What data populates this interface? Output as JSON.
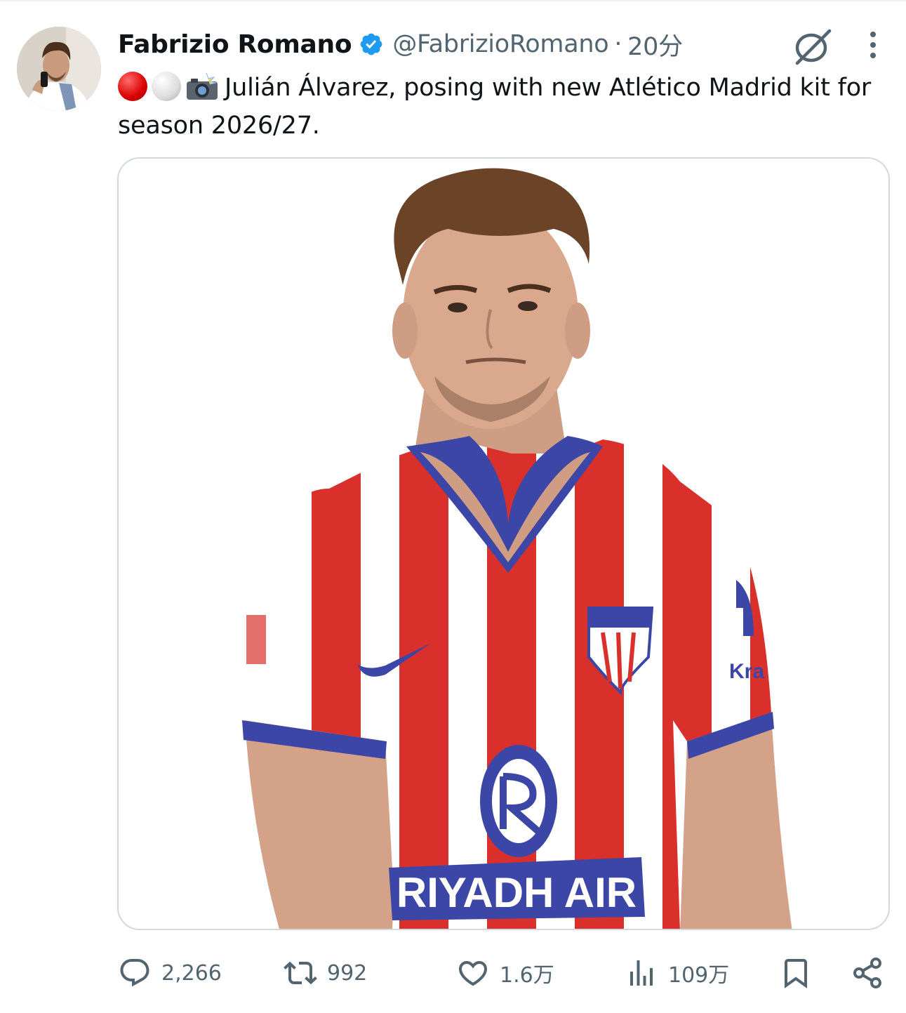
{
  "tweet": {
    "author_name": "Fabrizio Romano",
    "handle": "@FabrizioRomano",
    "separator": "·",
    "time": "20分",
    "text": "Julián Álvarez, posing with new Atlético Madrid kit for season 2026/27."
  },
  "media": {
    "sponsor_text": "RIYADH AIR",
    "sleeve_text": "Kra"
  },
  "actions": {
    "replies": "2,266",
    "retweets": "992",
    "likes": "1.6万",
    "views": "109万"
  },
  "colors": {
    "verified": "#1d9bf0",
    "text_secondary": "#536471",
    "kit_red": "#d9302b",
    "kit_blue": "#3c46a6"
  }
}
